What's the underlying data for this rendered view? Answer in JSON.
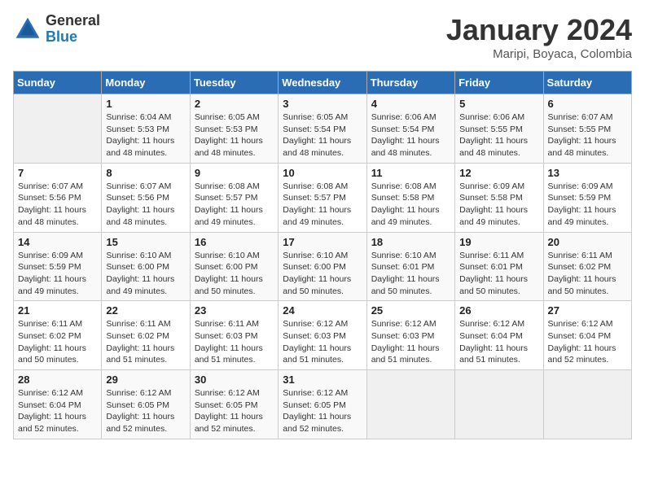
{
  "logo": {
    "general": "General",
    "blue": "Blue"
  },
  "title": "January 2024",
  "subtitle": "Maripi, Boyaca, Colombia",
  "weekdays": [
    "Sunday",
    "Monday",
    "Tuesday",
    "Wednesday",
    "Thursday",
    "Friday",
    "Saturday"
  ],
  "weeks": [
    [
      {
        "day": "",
        "sunrise": "",
        "sunset": "",
        "daylight": ""
      },
      {
        "day": "1",
        "sunrise": "Sunrise: 6:04 AM",
        "sunset": "Sunset: 5:53 PM",
        "daylight": "Daylight: 11 hours and 48 minutes."
      },
      {
        "day": "2",
        "sunrise": "Sunrise: 6:05 AM",
        "sunset": "Sunset: 5:53 PM",
        "daylight": "Daylight: 11 hours and 48 minutes."
      },
      {
        "day": "3",
        "sunrise": "Sunrise: 6:05 AM",
        "sunset": "Sunset: 5:54 PM",
        "daylight": "Daylight: 11 hours and 48 minutes."
      },
      {
        "day": "4",
        "sunrise": "Sunrise: 6:06 AM",
        "sunset": "Sunset: 5:54 PM",
        "daylight": "Daylight: 11 hours and 48 minutes."
      },
      {
        "day": "5",
        "sunrise": "Sunrise: 6:06 AM",
        "sunset": "Sunset: 5:55 PM",
        "daylight": "Daylight: 11 hours and 48 minutes."
      },
      {
        "day": "6",
        "sunrise": "Sunrise: 6:07 AM",
        "sunset": "Sunset: 5:55 PM",
        "daylight": "Daylight: 11 hours and 48 minutes."
      }
    ],
    [
      {
        "day": "7",
        "sunrise": "Sunrise: 6:07 AM",
        "sunset": "Sunset: 5:56 PM",
        "daylight": "Daylight: 11 hours and 48 minutes."
      },
      {
        "day": "8",
        "sunrise": "Sunrise: 6:07 AM",
        "sunset": "Sunset: 5:56 PM",
        "daylight": "Daylight: 11 hours and 48 minutes."
      },
      {
        "day": "9",
        "sunrise": "Sunrise: 6:08 AM",
        "sunset": "Sunset: 5:57 PM",
        "daylight": "Daylight: 11 hours and 49 minutes."
      },
      {
        "day": "10",
        "sunrise": "Sunrise: 6:08 AM",
        "sunset": "Sunset: 5:57 PM",
        "daylight": "Daylight: 11 hours and 49 minutes."
      },
      {
        "day": "11",
        "sunrise": "Sunrise: 6:08 AM",
        "sunset": "Sunset: 5:58 PM",
        "daylight": "Daylight: 11 hours and 49 minutes."
      },
      {
        "day": "12",
        "sunrise": "Sunrise: 6:09 AM",
        "sunset": "Sunset: 5:58 PM",
        "daylight": "Daylight: 11 hours and 49 minutes."
      },
      {
        "day": "13",
        "sunrise": "Sunrise: 6:09 AM",
        "sunset": "Sunset: 5:59 PM",
        "daylight": "Daylight: 11 hours and 49 minutes."
      }
    ],
    [
      {
        "day": "14",
        "sunrise": "Sunrise: 6:09 AM",
        "sunset": "Sunset: 5:59 PM",
        "daylight": "Daylight: 11 hours and 49 minutes."
      },
      {
        "day": "15",
        "sunrise": "Sunrise: 6:10 AM",
        "sunset": "Sunset: 6:00 PM",
        "daylight": "Daylight: 11 hours and 49 minutes."
      },
      {
        "day": "16",
        "sunrise": "Sunrise: 6:10 AM",
        "sunset": "Sunset: 6:00 PM",
        "daylight": "Daylight: 11 hours and 50 minutes."
      },
      {
        "day": "17",
        "sunrise": "Sunrise: 6:10 AM",
        "sunset": "Sunset: 6:00 PM",
        "daylight": "Daylight: 11 hours and 50 minutes."
      },
      {
        "day": "18",
        "sunrise": "Sunrise: 6:10 AM",
        "sunset": "Sunset: 6:01 PM",
        "daylight": "Daylight: 11 hours and 50 minutes."
      },
      {
        "day": "19",
        "sunrise": "Sunrise: 6:11 AM",
        "sunset": "Sunset: 6:01 PM",
        "daylight": "Daylight: 11 hours and 50 minutes."
      },
      {
        "day": "20",
        "sunrise": "Sunrise: 6:11 AM",
        "sunset": "Sunset: 6:02 PM",
        "daylight": "Daylight: 11 hours and 50 minutes."
      }
    ],
    [
      {
        "day": "21",
        "sunrise": "Sunrise: 6:11 AM",
        "sunset": "Sunset: 6:02 PM",
        "daylight": "Daylight: 11 hours and 50 minutes."
      },
      {
        "day": "22",
        "sunrise": "Sunrise: 6:11 AM",
        "sunset": "Sunset: 6:02 PM",
        "daylight": "Daylight: 11 hours and 51 minutes."
      },
      {
        "day": "23",
        "sunrise": "Sunrise: 6:11 AM",
        "sunset": "Sunset: 6:03 PM",
        "daylight": "Daylight: 11 hours and 51 minutes."
      },
      {
        "day": "24",
        "sunrise": "Sunrise: 6:12 AM",
        "sunset": "Sunset: 6:03 PM",
        "daylight": "Daylight: 11 hours and 51 minutes."
      },
      {
        "day": "25",
        "sunrise": "Sunrise: 6:12 AM",
        "sunset": "Sunset: 6:03 PM",
        "daylight": "Daylight: 11 hours and 51 minutes."
      },
      {
        "day": "26",
        "sunrise": "Sunrise: 6:12 AM",
        "sunset": "Sunset: 6:04 PM",
        "daylight": "Daylight: 11 hours and 51 minutes."
      },
      {
        "day": "27",
        "sunrise": "Sunrise: 6:12 AM",
        "sunset": "Sunset: 6:04 PM",
        "daylight": "Daylight: 11 hours and 52 minutes."
      }
    ],
    [
      {
        "day": "28",
        "sunrise": "Sunrise: 6:12 AM",
        "sunset": "Sunset: 6:04 PM",
        "daylight": "Daylight: 11 hours and 52 minutes."
      },
      {
        "day": "29",
        "sunrise": "Sunrise: 6:12 AM",
        "sunset": "Sunset: 6:05 PM",
        "daylight": "Daylight: 11 hours and 52 minutes."
      },
      {
        "day": "30",
        "sunrise": "Sunrise: 6:12 AM",
        "sunset": "Sunset: 6:05 PM",
        "daylight": "Daylight: 11 hours and 52 minutes."
      },
      {
        "day": "31",
        "sunrise": "Sunrise: 6:12 AM",
        "sunset": "Sunset: 6:05 PM",
        "daylight": "Daylight: 11 hours and 52 minutes."
      },
      {
        "day": "",
        "sunrise": "",
        "sunset": "",
        "daylight": ""
      },
      {
        "day": "",
        "sunrise": "",
        "sunset": "",
        "daylight": ""
      },
      {
        "day": "",
        "sunrise": "",
        "sunset": "",
        "daylight": ""
      }
    ]
  ]
}
